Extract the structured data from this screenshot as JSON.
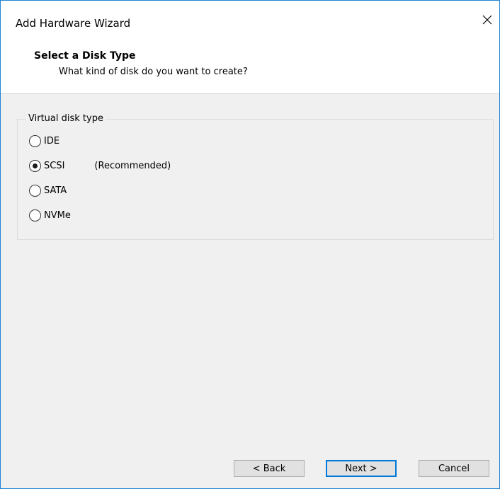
{
  "window": {
    "title": "Add Hardware Wizard"
  },
  "header": {
    "title": "Select a Disk Type",
    "subtitle": "What kind of disk do you want to create?"
  },
  "group": {
    "legend": "Virtual disk type",
    "options": [
      {
        "label": "IDE",
        "checked": false,
        "note": ""
      },
      {
        "label": "SCSI",
        "checked": true,
        "note": "(Recommended)"
      },
      {
        "label": "SATA",
        "checked": false,
        "note": ""
      },
      {
        "label": "NVMe",
        "checked": false,
        "note": ""
      }
    ]
  },
  "footer": {
    "back_label": "< Back",
    "next_label": "Next >",
    "cancel_label": "Cancel"
  },
  "colors": {
    "accent": "#0078d7",
    "window_border": "#1c83d6",
    "body_bg": "#f0f0f0"
  },
  "icons": {
    "close": "close-icon"
  }
}
